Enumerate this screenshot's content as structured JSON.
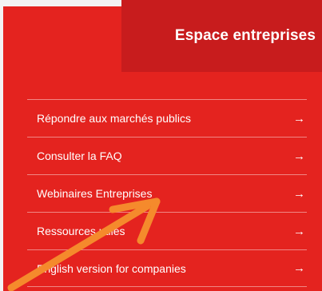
{
  "header": {
    "title": "Espace entreprises"
  },
  "menu": {
    "items": [
      {
        "label": "Répondre aux marchés publics",
        "arrow": "→"
      },
      {
        "label": "Consulter la FAQ",
        "arrow": "→"
      },
      {
        "label": "Webinaires Entreprises",
        "arrow": "→"
      },
      {
        "label": "Ressources utiles",
        "arrow": "→"
      },
      {
        "label": "English version for companies",
        "arrow": "→"
      }
    ]
  },
  "colors": {
    "panel_red": "#e4231f",
    "header_red": "#c81c1d",
    "annotation_arrow": "#f58a2c"
  },
  "annotation": {
    "icon": "arrow-annotation-icon"
  }
}
